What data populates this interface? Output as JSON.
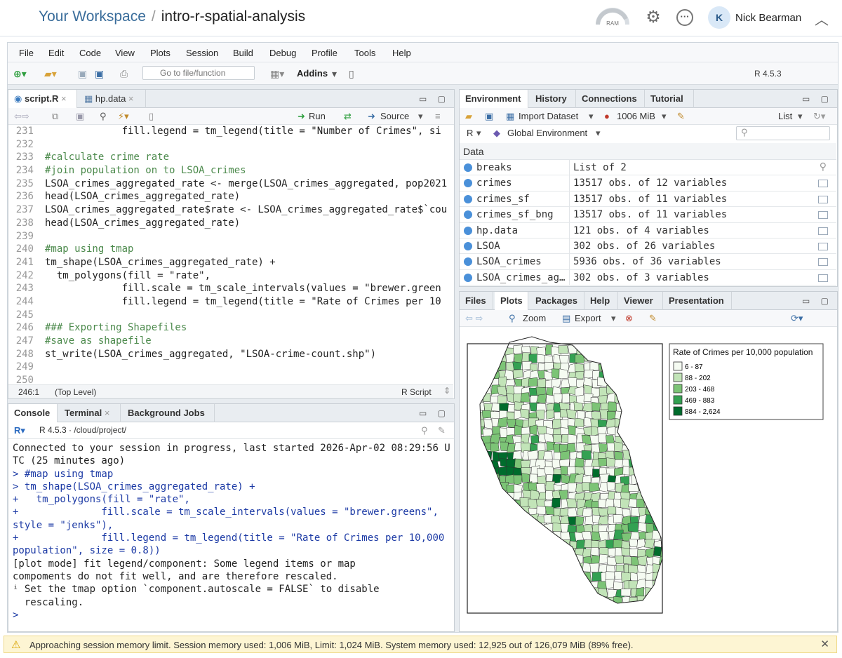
{
  "topbar": {
    "workspace": "Your Workspace",
    "separator": "/",
    "project": "intro-r-spatial-analysis",
    "ram_label": "RAM",
    "avatar_initial": "K",
    "username": "Nick Bearman"
  },
  "menubar": [
    "File",
    "Edit",
    "Code",
    "View",
    "Plots",
    "Session",
    "Build",
    "Debug",
    "Profile",
    "Tools",
    "Help"
  ],
  "toolbar": {
    "goto_placeholder": "Go to file/function",
    "addins": "Addins",
    "r_version": "R 4.5.3"
  },
  "editor": {
    "tabs": [
      "script.R",
      "hp.data"
    ],
    "run": "Run",
    "source": "Source",
    "lines": [
      {
        "n": "231",
        "t": "             fill.legend = tm_legend(title = \"Number of Crimes\", si",
        "k": "code"
      },
      {
        "n": "232",
        "t": "",
        "k": "code"
      },
      {
        "n": "233",
        "t": "#calculate crime rate",
        "k": "cm"
      },
      {
        "n": "234",
        "t": "#join population on to LSOA_crimes",
        "k": "cm"
      },
      {
        "n": "235",
        "t": "LSOA_crimes_aggregated_rate <- merge(LSOA_crimes_aggregated, pop2021",
        "k": "code"
      },
      {
        "n": "236",
        "t": "head(LSOA_crimes_aggregated_rate)",
        "k": "code"
      },
      {
        "n": "237",
        "t": "LSOA_crimes_aggregated_rate$rate <- LSOA_crimes_aggregated_rate$`cou",
        "k": "code"
      },
      {
        "n": "238",
        "t": "head(LSOA_crimes_aggregated_rate)",
        "k": "code"
      },
      {
        "n": "239",
        "t": "",
        "k": "code"
      },
      {
        "n": "240",
        "t": "#map using tmap",
        "k": "cm"
      },
      {
        "n": "241",
        "t": "tm_shape(LSOA_crimes_aggregated_rate) +",
        "k": "code"
      },
      {
        "n": "242",
        "t": "  tm_polygons(fill = \"rate\",",
        "k": "code"
      },
      {
        "n": "243",
        "t": "             fill.scale = tm_scale_intervals(values = \"brewer.green",
        "k": "code"
      },
      {
        "n": "244",
        "t": "             fill.legend = tm_legend(title = \"Rate of Crimes per 10",
        "k": "code"
      },
      {
        "n": "245",
        "t": "",
        "k": "code"
      },
      {
        "n": "246",
        "t": "### Exporting Shapefiles",
        "k": "cm"
      },
      {
        "n": "247",
        "t": "#save as shapefile",
        "k": "cm"
      },
      {
        "n": "248",
        "t": "st_write(LSOA_crimes_aggregated, \"LSOA-crime-count.shp\")",
        "k": "code"
      },
      {
        "n": "249",
        "t": "",
        "k": "code"
      },
      {
        "n": "250",
        "t": "",
        "k": "code"
      }
    ],
    "status_pos": "246:1",
    "status_scope": "(Top Level)",
    "status_type": "R Script"
  },
  "console": {
    "tabs": [
      "Console",
      "Terminal",
      "Background Jobs"
    ],
    "path": "R 4.5.3 · /cloud/project/",
    "lines": [
      {
        "t": "Connected to your session in progress, last started 2026-Apr-02 08:29:56 U",
        "k": "out"
      },
      {
        "t": "TC (25 minutes ago)",
        "k": "out"
      },
      {
        "t": "> #map using tmap",
        "k": "cin"
      },
      {
        "t": "> tm_shape(LSOA_crimes_aggregated_rate) +",
        "k": "cin"
      },
      {
        "t": "+   tm_polygons(fill = \"rate\",",
        "k": "cin"
      },
      {
        "t": "+              fill.scale = tm_scale_intervals(values = \"brewer.greens\",",
        "k": "cin"
      },
      {
        "t": "style = \"jenks\"),",
        "k": "cin"
      },
      {
        "t": "+              fill.legend = tm_legend(title = \"Rate of Crimes per 10,000",
        "k": "cin"
      },
      {
        "t": "population\", size = 0.8))",
        "k": "cin"
      },
      {
        "t": "[plot mode] fit legend/component: Some legend items or map",
        "k": "out"
      },
      {
        "t": "compoments do not fit well, and are therefore rescaled.",
        "k": "out"
      },
      {
        "t": "ⁱ Set the tmap option `component.autoscale = FALSE` to disable",
        "k": "out"
      },
      {
        "t": "  rescaling.",
        "k": "out"
      },
      {
        "t": ">",
        "k": "cin"
      }
    ]
  },
  "environment": {
    "tabs": [
      "Environment",
      "History",
      "Connections",
      "Tutorial"
    ],
    "import": "Import Dataset",
    "memory": "1006 MiB",
    "list": "List",
    "lang": "R",
    "scope": "Global Environment",
    "section": "Data",
    "rows": [
      {
        "name": "breaks",
        "value": "List of  2"
      },
      {
        "name": "crimes",
        "value": "13517 obs. of 12 variables"
      },
      {
        "name": "crimes_sf",
        "value": "13517 obs. of 11 variables"
      },
      {
        "name": "crimes_sf_bng",
        "value": "13517 obs. of 11 variables"
      },
      {
        "name": "hp.data",
        "value": "121 obs. of 4 variables"
      },
      {
        "name": "LSOA",
        "value": "302 obs. of 26 variables"
      },
      {
        "name": "LSOA_crimes",
        "value": "5936 obs. of 36 variables"
      },
      {
        "name": "LSOA_crimes_ag…",
        "value": "302 obs. of 3 variables"
      }
    ]
  },
  "files": {
    "tabs": [
      "Files",
      "Plots",
      "Packages",
      "Help",
      "Viewer",
      "Presentation"
    ],
    "zoom": "Zoom",
    "export": "Export"
  },
  "plot": {
    "legend_title": "Rate of Crimes per 10,000 population",
    "legend_items": [
      {
        "label": "6 - 87",
        "color": "#f5fbf2"
      },
      {
        "label": "88 - 202",
        "color": "#c2e4b8"
      },
      {
        "label": "203 - 468",
        "color": "#7cc476"
      },
      {
        "label": "469 - 883",
        "color": "#33a152"
      },
      {
        "label": "884 - 2,624",
        "color": "#006c2c"
      }
    ]
  },
  "warning": "Approaching session memory limit. Session memory used: 1,006 MiB, Limit: 1,024 MiB. System memory used: 12,925 out of 126,079 MiB (89% free)."
}
